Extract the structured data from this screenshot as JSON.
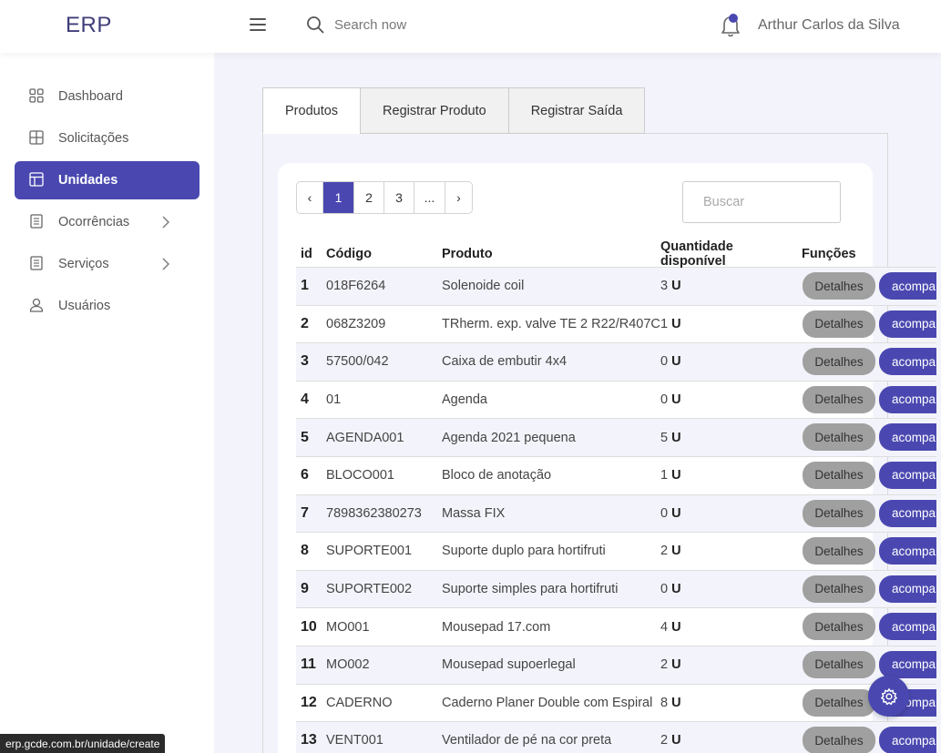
{
  "app": {
    "brand": "ERP"
  },
  "header": {
    "search_placeholder": "Search now",
    "user_name": "Arthur Carlos da Silva"
  },
  "sidebar": {
    "items": [
      {
        "label": "Dashboard",
        "icon": "grid-icon"
      },
      {
        "label": "Solicitações",
        "icon": "table-icon"
      },
      {
        "label": "Unidades",
        "icon": "layout-icon",
        "active": true
      },
      {
        "label": "Ocorrências",
        "icon": "document-icon",
        "has_submenu": true
      },
      {
        "label": "Serviços",
        "icon": "document-icon",
        "has_submenu": true
      },
      {
        "label": "Usuários",
        "icon": "user-icon"
      }
    ]
  },
  "tabs": [
    {
      "label": "Produtos",
      "active": true
    },
    {
      "label": "Registrar Produto"
    },
    {
      "label": "Registrar Saída"
    }
  ],
  "pagination": {
    "prev": "‹",
    "pages": [
      "1",
      "2",
      "3",
      "..."
    ],
    "next": "›",
    "current": "1"
  },
  "table_search": {
    "placeholder": "Buscar"
  },
  "table": {
    "headers": [
      "id",
      "Código",
      "Produto",
      "Quantidade disponível",
      "Funções"
    ],
    "unit": "U",
    "details_label": "Detalhes",
    "track_label": "acompanhar",
    "rows": [
      {
        "id": "1",
        "code": "018F6264",
        "product": "Solenoide coil",
        "qty": "3"
      },
      {
        "id": "2",
        "code": "068Z3209",
        "product": "TRherm. exp. valve TE 2 R22/R407C",
        "qty": "1"
      },
      {
        "id": "3",
        "code": "57500/042",
        "product": "Caixa de embutir 4x4",
        "qty": "0"
      },
      {
        "id": "4",
        "code": "01",
        "product": "Agenda",
        "qty": "0"
      },
      {
        "id": "5",
        "code": "AGENDA001",
        "product": "Agenda 2021 pequena",
        "qty": "5"
      },
      {
        "id": "6",
        "code": "BLOCO001",
        "product": "Bloco de anotação",
        "qty": "1"
      },
      {
        "id": "7",
        "code": "7898362380273",
        "product": "Massa FIX",
        "qty": "0"
      },
      {
        "id": "8",
        "code": "SUPORTE001",
        "product": "Suporte duplo para hortifruti",
        "qty": "2"
      },
      {
        "id": "9",
        "code": "SUPORTE002",
        "product": "Suporte simples para hortifruti",
        "qty": "0"
      },
      {
        "id": "10",
        "code": "MO001",
        "product": "Mousepad 17.com",
        "qty": "4"
      },
      {
        "id": "11",
        "code": "MO002",
        "product": "Mousepad supoerlegal",
        "qty": "2"
      },
      {
        "id": "12",
        "code": "CADERNO",
        "product": "Caderno Planer Double com Espiral",
        "qty": "8"
      },
      {
        "id": "13",
        "code": "VENT001",
        "product": "Ventilador de pé na cor preta",
        "qty": "2"
      }
    ]
  },
  "status_bar": {
    "url": "erp.gcde.com.br/unidade/create"
  }
}
